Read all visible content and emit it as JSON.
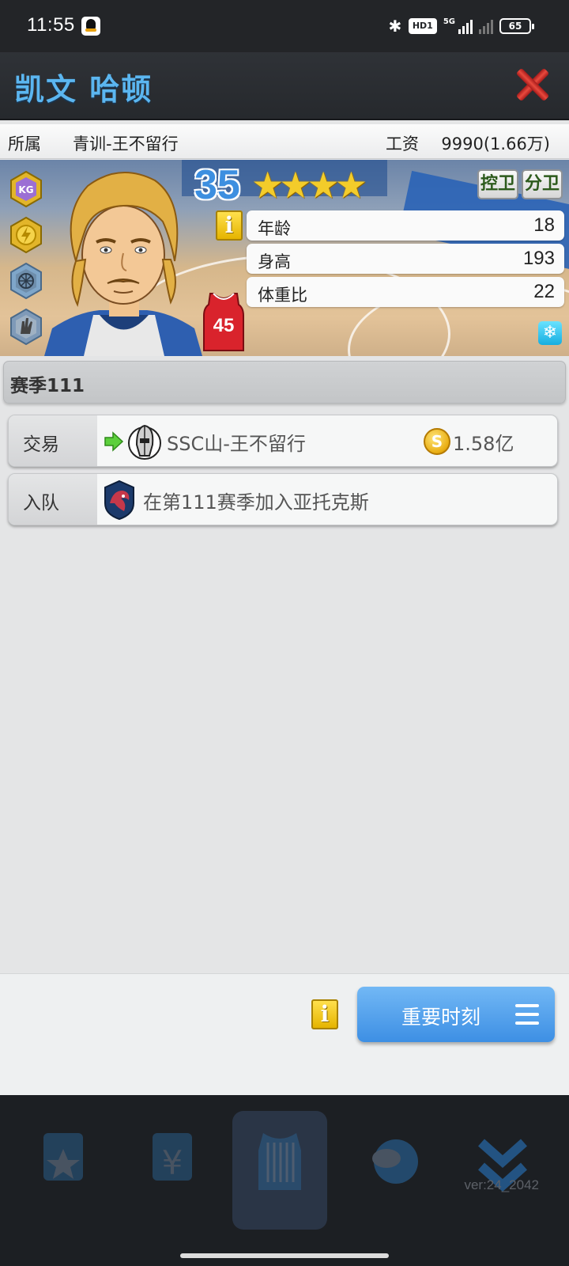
{
  "status_bar": {
    "time": "11:55",
    "network": "HD1",
    "network_type": "5G",
    "battery": "65"
  },
  "header": {
    "title": "凯文 哈顿"
  },
  "info_row": {
    "affiliation_label": "所属",
    "affiliation_value": "青训-王不留行",
    "salary_label": "工资",
    "salary_value": "9990(1.66万)"
  },
  "player": {
    "rating": "35",
    "stars": 4,
    "jersey_number": "45",
    "positions": [
      "控卫",
      "分卫"
    ],
    "stats": [
      {
        "label": "年龄",
        "value": "18"
      },
      {
        "label": "身高",
        "value": "193"
      },
      {
        "label": "体重比",
        "value": "22"
      }
    ],
    "badges": [
      {
        "icon": "kg-badge-icon",
        "text": "KG",
        "color": "#9b6fd4"
      },
      {
        "icon": "lightning-badge-icon",
        "color": "#e2b52a"
      },
      {
        "icon": "net-badge-icon",
        "color": "#7fa6c9"
      },
      {
        "icon": "hand-badge-icon",
        "color": "#7f9ab8"
      }
    ]
  },
  "season": {
    "title": "赛季111"
  },
  "events": [
    {
      "type": "交易",
      "icon": "green-arrow-icon",
      "team_logo": "knight-logo-icon",
      "text": "SSC山-王不留行",
      "coin_amount": "1.58亿"
    },
    {
      "type": "入队",
      "team_logo": "dragon-logo-icon",
      "text": "在第111赛季加入亚托克斯"
    }
  ],
  "actions": {
    "moments_label": "重要时刻"
  },
  "bottom_nav": {
    "version": "ver:24_2042"
  },
  "colors": {
    "title_blue": "#5bb6f0",
    "button_blue": "#3d8fe4",
    "info_yellow": "#ffe04d"
  }
}
